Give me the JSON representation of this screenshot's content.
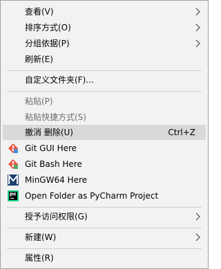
{
  "menu": {
    "view": "查看(V)",
    "sort_by": "排序方式(O)",
    "group_by": "分组依据(P)",
    "refresh": "刷新(E)",
    "customize_folder": "自定义文件夹(F)...",
    "paste": "粘贴(P)",
    "paste_shortcut": "粘贴快捷方式(S)",
    "undo_delete": "撤消 删除(U)",
    "undo_shortcut": "Ctrl+Z",
    "git_gui": "Git GUI Here",
    "git_bash": "Git Bash Here",
    "mingw": "MinGW64 Here",
    "pycharm": "Open Folder as PyCharm Project",
    "give_access": "授予访问权限(G)",
    "new": "新建(W)",
    "properties": "属性(R)"
  },
  "icons": {
    "git_gui": "git-gui-icon",
    "git_bash": "git-bash-icon",
    "mingw": "mingw64-icon",
    "pycharm": "pycharm-icon",
    "submenu": "chevron-right-icon"
  },
  "colors": {
    "menu_bg": "#f2f2f2",
    "highlight": "#d9d9d9",
    "disabled_text": "#6d6d6d",
    "separator": "#cfcfcf"
  }
}
